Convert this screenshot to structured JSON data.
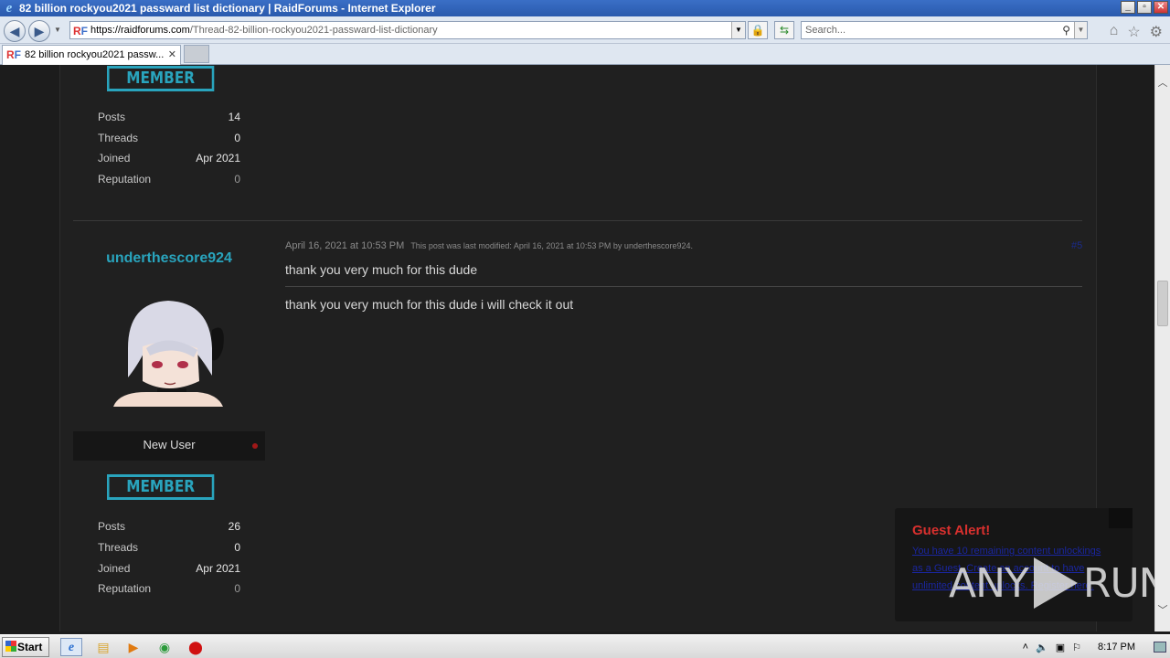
{
  "window": {
    "title": "82 billion rockyou2021 passward list dictionary | RaidForums - Internet Explorer",
    "min": "_",
    "max": "▫",
    "close": "✕"
  },
  "address": {
    "host": "https://raidforums.com",
    "path": "/Thread-82-billion-rockyou2021-passward-list-dictionary",
    "favicon_r": "R",
    "favicon_f": "F"
  },
  "search": {
    "placeholder": "Search..."
  },
  "tab": {
    "label": "82 billion rockyou2021 passw...",
    "close": "✕"
  },
  "user1": {
    "badge": "MEMBER",
    "stats": [
      {
        "k": "Posts",
        "v": "14"
      },
      {
        "k": "Threads",
        "v": "0"
      },
      {
        "k": "Joined",
        "v": "Apr 2021"
      },
      {
        "k": "Reputation",
        "v": "0"
      }
    ]
  },
  "user2": {
    "name": "underthescore924",
    "rank": "New User",
    "badge": "MEMBER",
    "stats": [
      {
        "k": "Posts",
        "v": "26"
      },
      {
        "k": "Threads",
        "v": "0"
      },
      {
        "k": "Joined",
        "v": "Apr 2021"
      },
      {
        "k": "Reputation",
        "v": "0"
      }
    ]
  },
  "post": {
    "date": "April 16, 2021 at 10:53 PM",
    "modified": "This post was last modified: April 16, 2021 at 10:53 PM by underthescore924.",
    "number": "#5",
    "title": "thank you very much for this dude",
    "body": "thank you very much for this dude i will check it out"
  },
  "alert": {
    "title": "Guest Alert!",
    "body": "You have 10 remaining content unlockings as a Guest. Create an account to have unlimited content unlocks. Register here."
  },
  "watermark": {
    "left": "ANY",
    "right": "RUN"
  },
  "taskbar": {
    "start": "Start",
    "time": "8:17 PM"
  }
}
